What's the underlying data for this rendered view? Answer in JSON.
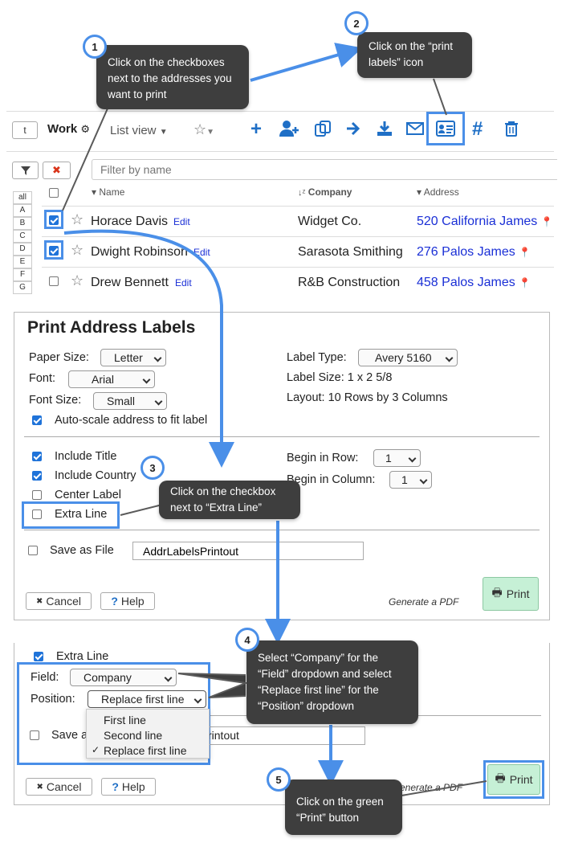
{
  "toolbar": {
    "t_button": "t",
    "list_title": "Work",
    "view_label": "List view",
    "filter_placeholder": "Filter by name"
  },
  "columns": {
    "name": "Name",
    "company": "Company",
    "address": "Address"
  },
  "alpha": [
    "all",
    "A",
    "B",
    "C",
    "D",
    "E",
    "F",
    "G"
  ],
  "contacts": [
    {
      "name": "Horace Davis",
      "edit": "Edit",
      "company": "Widget Co.",
      "address": "520 California James",
      "checked": true
    },
    {
      "name": "Dwight Robinson",
      "edit": "Edit",
      "company": "Sarasota Smithing",
      "address": "276 Palos James",
      "checked": true
    },
    {
      "name": "Drew Bennett",
      "edit": "Edit",
      "company": "R&B Construction",
      "address": "458 Palos James",
      "checked": false
    }
  ],
  "print_panel": {
    "title": "Print Address Labels",
    "paper_size_label": "Paper Size:",
    "paper_size_value": "Letter",
    "font_label": "Font:",
    "font_value": "Arial",
    "font_size_label": "Font Size:",
    "font_size_value": "Small",
    "autoscale_label": "Auto-scale address to fit label",
    "label_type_label": "Label Type:",
    "label_type_value": "Avery 5160",
    "label_size_text": "Label Size: 1 x 2 5/8",
    "layout_text": "Layout: 10 Rows by 3 Columns",
    "include_title": "Include Title",
    "include_country": "Include Country",
    "center_label": "Center Label",
    "extra_line": "Extra Line",
    "begin_row_label": "Begin in Row:",
    "begin_row_value": "1",
    "begin_col_label": "Begin in Column:",
    "begin_col_value": "1",
    "save_file_label": "Save as File",
    "save_file_value": "AddrLabelsPrintout",
    "cancel": "Cancel",
    "help": "Help",
    "generate_pdf": "Generate a PDF",
    "print": "Print"
  },
  "panel2": {
    "extra_line": "Extra Line",
    "field_label": "Field:",
    "field_value": "Company",
    "position_label": "Position:",
    "position_value": "Replace first line",
    "options": [
      "First line",
      "Second line",
      "Replace first line"
    ],
    "save_partial": "Save a",
    "file_partial": "rintout",
    "cancel": "Cancel",
    "help": "Help",
    "generate_partial": "enerate a PDF",
    "print": "Print"
  },
  "callouts": {
    "c1": "Click on the checkboxes next to the addresses you want to print",
    "c2": "Click on the “print labels” icon",
    "c3": "Click on the checkbox next to “Extra Line”",
    "c4": "Select “Company” for the “Field” dropdown and select “Replace first line” for the “Position” dropdown",
    "c5": "Click on the green “Print” button"
  },
  "badges": [
    "1",
    "2",
    "3",
    "4",
    "5"
  ],
  "colors": {
    "accent": "#4a8fe8",
    "link": "#1a2fd6",
    "print_green": "#c6f0d6",
    "callout": "#3e3e3e",
    "delete_red": "#d9341a"
  }
}
